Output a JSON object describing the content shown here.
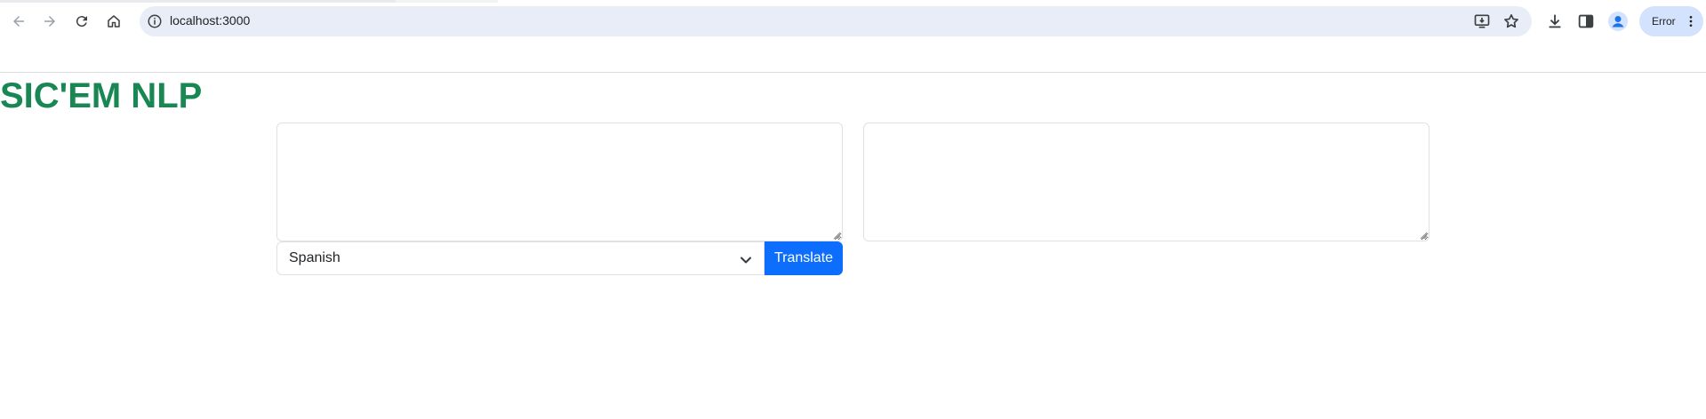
{
  "browser": {
    "url": "localhost:3000",
    "profile_status": "Error"
  },
  "page": {
    "title": "SIC'EM NLP",
    "title_color": "#198754"
  },
  "translator": {
    "source_text": "",
    "output_text": "",
    "language_selected": "Spanish",
    "translate_label": "Translate",
    "button_color": "#0d6efd"
  }
}
